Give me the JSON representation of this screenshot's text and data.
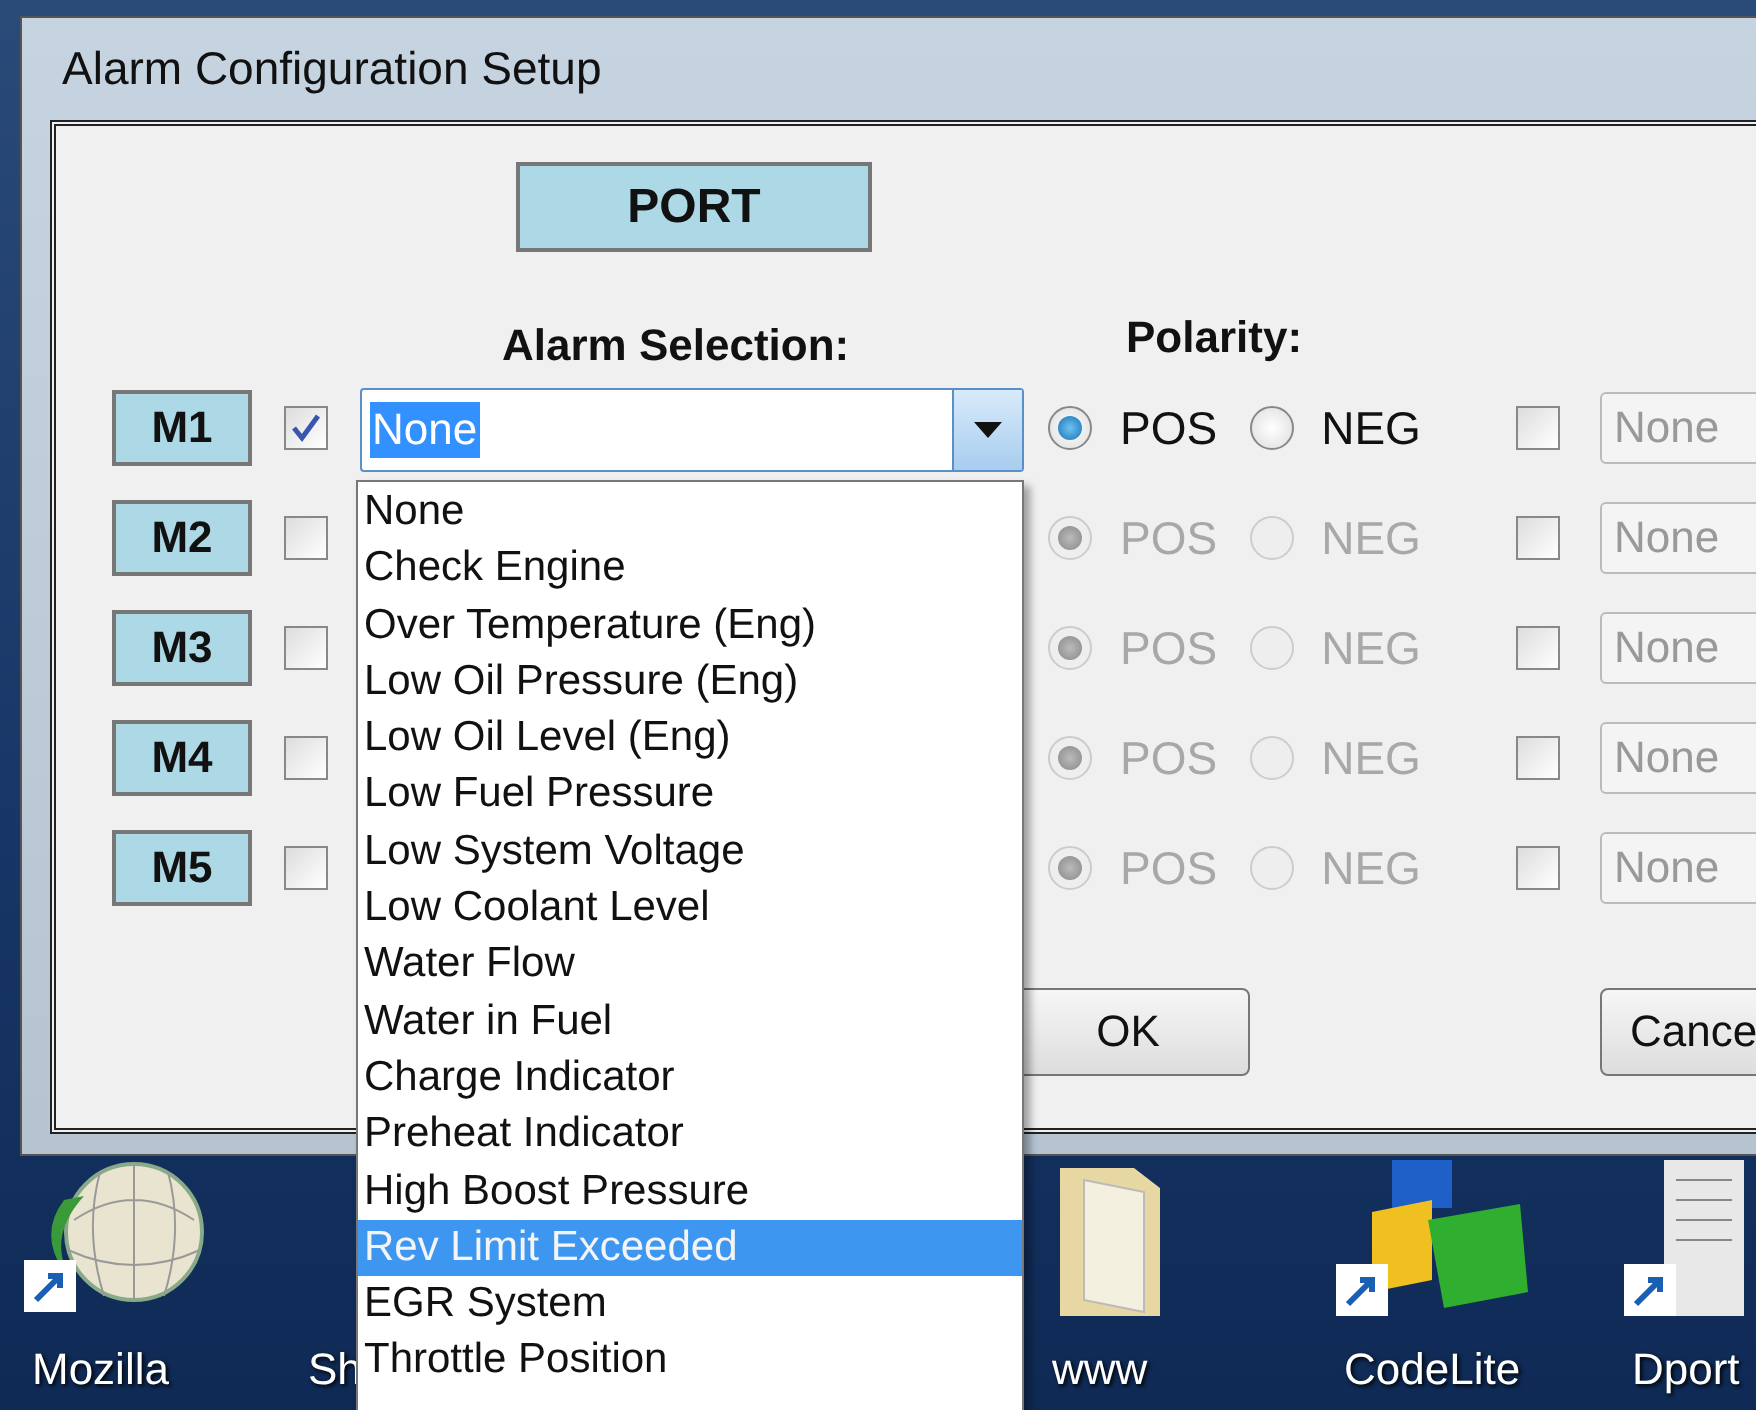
{
  "window": {
    "title": "Alarm Configuration Setup"
  },
  "header_button": "PORT",
  "column_headers": {
    "alarm_selection": "Alarm Selection:",
    "polarity": "Polarity:"
  },
  "rows": [
    {
      "label": "M1",
      "checked": true,
      "alarm": "None",
      "polarity_disabled": false,
      "polarity": [
        {
          "label": "POS",
          "selected": true
        },
        {
          "label": "NEG",
          "selected": false
        }
      ],
      "extra_checked": false,
      "extra_value": "None"
    },
    {
      "label": "M2",
      "checked": false,
      "polarity_disabled": true,
      "polarity": [
        {
          "label": "POS",
          "selected": true
        },
        {
          "label": "NEG",
          "selected": false
        }
      ],
      "extra_checked": false,
      "extra_value": "None"
    },
    {
      "label": "M3",
      "checked": false,
      "polarity_disabled": true,
      "polarity": [
        {
          "label": "POS",
          "selected": true
        },
        {
          "label": "NEG",
          "selected": false
        }
      ],
      "extra_checked": false,
      "extra_value": "None"
    },
    {
      "label": "M4",
      "checked": false,
      "polarity_disabled": true,
      "polarity": [
        {
          "label": "POS",
          "selected": true
        },
        {
          "label": "NEG",
          "selected": false
        }
      ],
      "extra_checked": false,
      "extra_value": "None"
    },
    {
      "label": "M5",
      "checked": false,
      "polarity_disabled": true,
      "polarity": [
        {
          "label": "POS",
          "selected": true
        },
        {
          "label": "NEG",
          "selected": false
        }
      ],
      "extra_checked": false,
      "extra_value": "None"
    }
  ],
  "alarm_dropdown": {
    "items": [
      {
        "label": "None",
        "selected": false
      },
      {
        "label": "Check Engine",
        "selected": false
      },
      {
        "label": "Over Temperature (Eng)",
        "selected": false
      },
      {
        "label": "Low Oil Pressure (Eng)",
        "selected": false
      },
      {
        "label": "Low Oil Level (Eng)",
        "selected": false
      },
      {
        "label": "Low Fuel Pressure",
        "selected": false
      },
      {
        "label": "Low System Voltage",
        "selected": false
      },
      {
        "label": "Low Coolant Level",
        "selected": false
      },
      {
        "label": "Water Flow",
        "selected": false
      },
      {
        "label": "Water in Fuel",
        "selected": false
      },
      {
        "label": "Charge Indicator",
        "selected": false
      },
      {
        "label": "Preheat Indicator",
        "selected": false
      },
      {
        "label": "High Boost Pressure",
        "selected": false
      },
      {
        "label": "Rev Limit Exceeded",
        "selected": true
      },
      {
        "label": "EGR System",
        "selected": false
      },
      {
        "label": "Throttle Position",
        "selected": false
      }
    ]
  },
  "buttons": [
    {
      "label": "OK"
    },
    {
      "label": "Cance"
    }
  ],
  "desktop_icons": [
    {
      "label": "Mozilla",
      "kind": "globe"
    },
    {
      "label": "Sh",
      "kind": "hidden"
    },
    {
      "label": "www",
      "kind": "folder"
    },
    {
      "label": "CodeLite",
      "kind": "cubes"
    },
    {
      "label": "Dport",
      "kind": "document"
    }
  ]
}
